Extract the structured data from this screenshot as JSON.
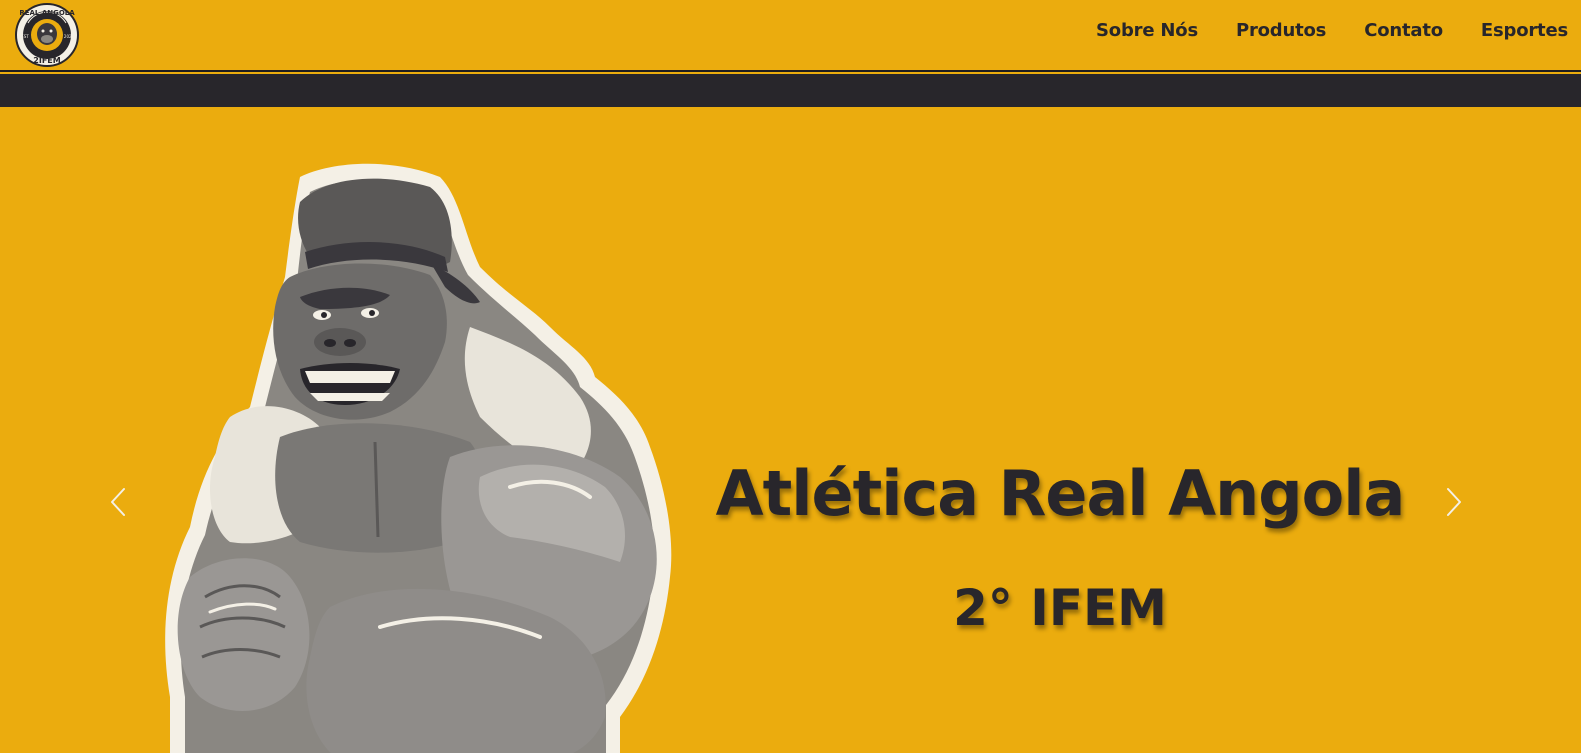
{
  "brand": {
    "logo_text_top": "REAL ANGOLA",
    "logo_text_bottom": "2IFEM",
    "logo_est_left": "EST",
    "logo_est_right": "2022"
  },
  "nav": {
    "items": [
      {
        "label": "Sobre Nós"
      },
      {
        "label": "Produtos"
      },
      {
        "label": "Contato"
      },
      {
        "label": "Esportes"
      }
    ]
  },
  "hero": {
    "title": "Atlética Real Angola",
    "subtitle": "2° IFEM",
    "mascot_icon": "gorilla-mascot",
    "prev_icon": "chevron-left-icon",
    "next_icon": "chevron-right-icon"
  },
  "colors": {
    "accent": "#EBAC0E",
    "dark": "#28262B"
  }
}
